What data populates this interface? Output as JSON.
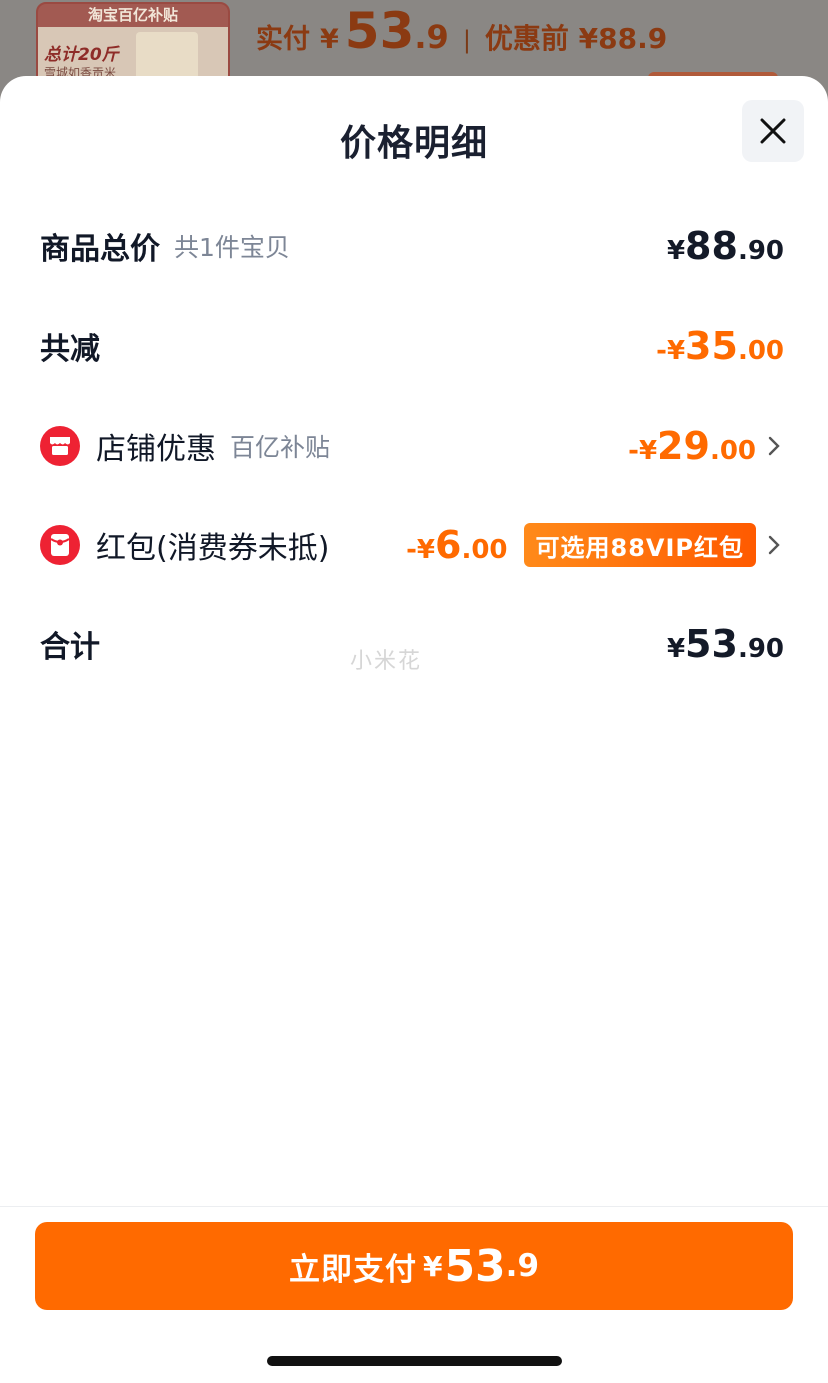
{
  "background": {
    "thumb_tag": "淘宝百亿补贴",
    "thumb_main": "总计20斤",
    "thumb_sub": "雪城如香贡米",
    "actual_label": "实付",
    "actual_yen": "¥",
    "actual_int": "53",
    "actual_dec": ".9",
    "separator": "|",
    "prev_label": "优惠前 ¥88.9"
  },
  "sheet": {
    "title": "价格明细",
    "close_icon": "close-icon",
    "rows": {
      "subtotal": {
        "label": "商品总价",
        "sub": "共1件宝贝",
        "yen": "¥",
        "int": "88",
        "dec": ".90"
      },
      "total_discount": {
        "label": "共减",
        "yen": "-¥",
        "int": "35",
        "dec": ".00"
      },
      "store_discount": {
        "label": "店铺优惠",
        "sub": "百亿补贴",
        "yen": "-¥",
        "int": "29",
        "dec": ".00",
        "icon": "store-icon"
      },
      "red_packet": {
        "label": "红包(消费券未抵)",
        "yen": "-¥",
        "int": "6",
        "dec": ".00",
        "tag": "可选用88VIP红包",
        "icon": "red-packet-icon"
      },
      "total": {
        "label": "合计",
        "yen": "¥",
        "int": "53",
        "dec": ".90"
      }
    },
    "watermark": "小米花"
  },
  "footer": {
    "pay_label": "立即支付",
    "pay_yen": "¥",
    "pay_int": "53",
    "pay_dec": ".9"
  },
  "colors": {
    "accent": "#ff6a00",
    "text_dark": "#141a28",
    "text_sub": "#7d8696",
    "icon_red": "#ee2233"
  }
}
